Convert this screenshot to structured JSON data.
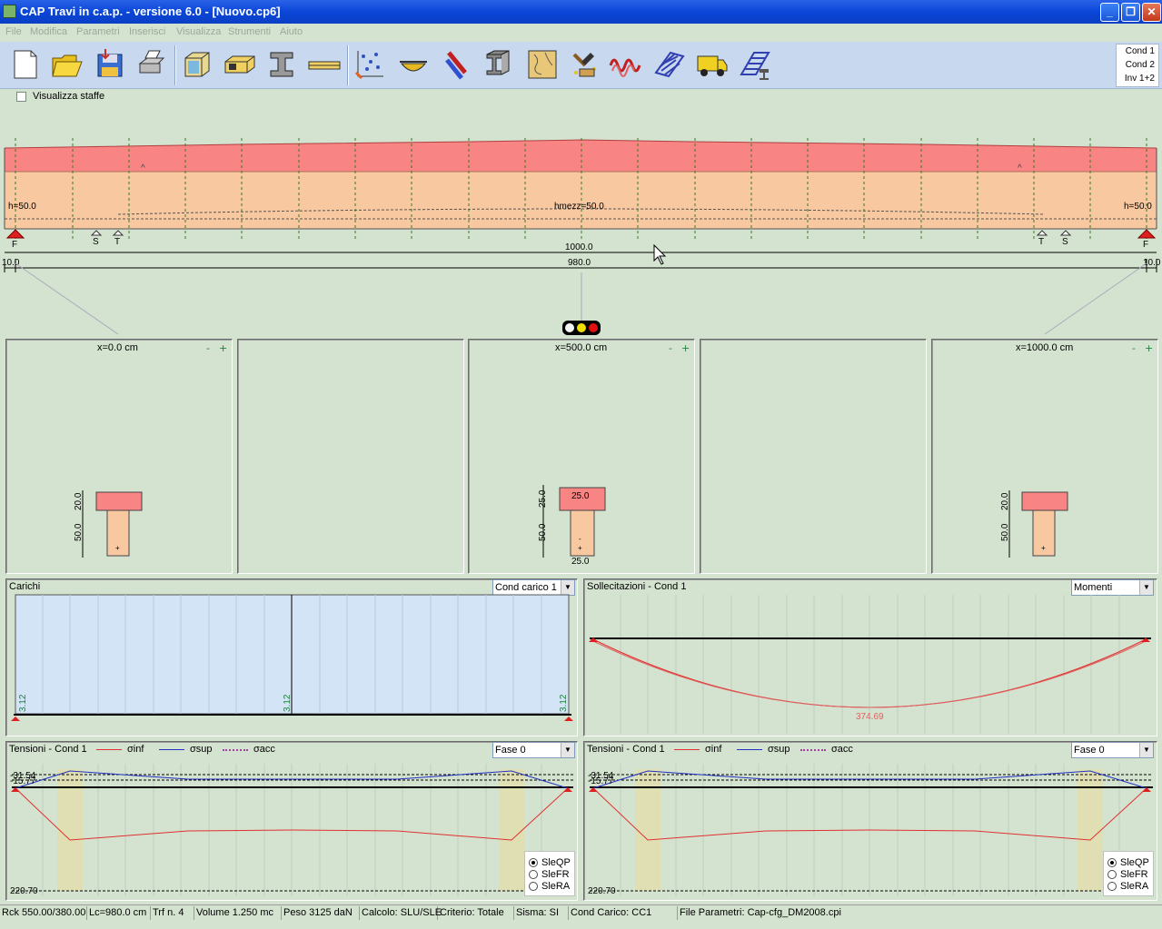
{
  "window": {
    "title": "CAP Travi in c.a.p. - versione 6.0 - [Nuovo.cp6]"
  },
  "menu": [
    "File",
    "Modifica",
    "Parametri",
    "Inserisci",
    "Visualizza",
    "Strumenti",
    "Aiuto"
  ],
  "toolbar": {
    "icons": [
      "new-file-icon",
      "open-folder-icon",
      "save-disk-icon",
      "print-icon",
      "beam-box-icon",
      "beam-section-icon",
      "i-beam-icon",
      "beam-long-icon",
      "tendons-icon",
      "bowl-section-icon",
      "strand-icon",
      "steel-section-icon",
      "map-icon",
      "hammer-icon",
      "spring-icon",
      "rebar-cage-icon",
      "truck-icon",
      "stirrup-cage-icon"
    ],
    "conditions": [
      "Cond 1",
      "Cond 2",
      "Inv 1+2"
    ]
  },
  "options": {
    "show_stirrups_label": "Visualizza staffe",
    "show_stirrups": false
  },
  "beam": {
    "h_left": "h=50.0",
    "h_mid": "hmezz=50.0",
    "h_right": "h=50.0",
    "span_total": "1000.0",
    "span_net": "980.0",
    "end_left": "10.0",
    "end_right": "10.0",
    "support_label": "F",
    "markers": [
      "S",
      "T",
      "T",
      "S"
    ],
    "hinge_label": "^"
  },
  "sections": [
    {
      "label": "x=0.0 cm",
      "dim_top": "20.0",
      "dim_web": "50.0"
    },
    {
      "label": ""
    },
    {
      "label": "x=500.0 cm",
      "dim_top": "25.0",
      "dim_web": "50.0",
      "width_top": "25.0",
      "width_bot": "25.0"
    },
    {
      "label": ""
    },
    {
      "label": "x=1000.0 cm",
      "dim_top": "20.0",
      "dim_web": "50.0"
    }
  ],
  "section_controls": {
    "minus": "-",
    "plus": "+"
  },
  "loads": {
    "title": "Carichi",
    "select": "Cond carico 1",
    "values": [
      "3.12",
      "3.12",
      "3.12"
    ]
  },
  "forces": {
    "title": "Sollecitazioni - Cond 1",
    "select": "Momenti",
    "max_value": "374.69"
  },
  "stress": [
    {
      "title": "Tensioni - Cond 1",
      "select": "Fase 0",
      "legend": [
        "σinf",
        "σsup",
        "σacc"
      ],
      "top_values": [
        "-31.54",
        "-15.77"
      ],
      "bottom_value": "220.70",
      "radios": [
        "SleQP",
        "SleFR",
        "SleRA"
      ],
      "selected": 0
    },
    {
      "title": "Tensioni - Cond 1",
      "select": "Fase 0",
      "legend": [
        "σinf",
        "σsup",
        "σacc"
      ],
      "top_values": [
        "-31.54",
        "-15.77"
      ],
      "bottom_value": "220.70",
      "radios": [
        "SleQP",
        "SleFR",
        "SleRA"
      ],
      "selected": 0
    }
  ],
  "colors": {
    "flange": "#f98484",
    "web": "#f8c8a0",
    "loads_bg": "#d2e4f5",
    "sigma_inf": "#e03030",
    "sigma_sup": "#2030c0",
    "background": "#d4e3cf"
  },
  "status": [
    "Rck 550.00/380.00",
    "Lc=980.0 cm",
    "Trf n. 4",
    "Volume 1.250 mc",
    "Peso 3125 daN",
    "Calcolo: SLU/SLE",
    "Criterio: Totale",
    "Sisma: SI",
    "Cond Carico: CC1",
    "File Parametri: Cap-cfg_DM2008.cpi"
  ]
}
